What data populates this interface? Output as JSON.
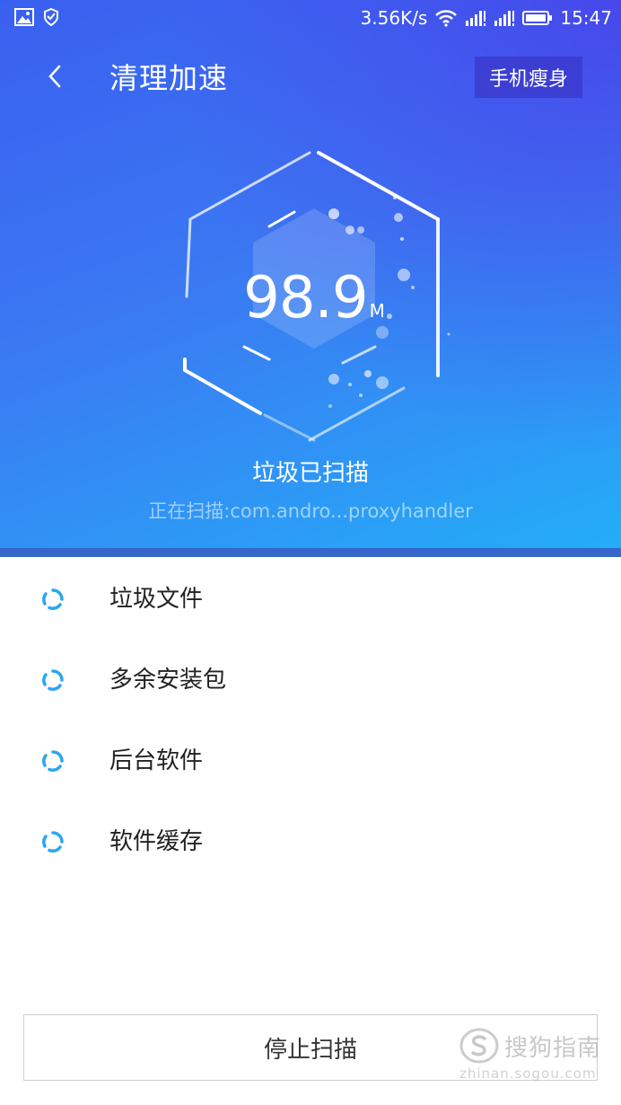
{
  "status_bar": {
    "speed": "3.56K/s",
    "time": "15:47",
    "icons": [
      "image-icon",
      "shield-icon",
      "wifi-icon",
      "signal-icon",
      "signal-icon",
      "battery-icon"
    ]
  },
  "header": {
    "back_icon": "chevron-left-icon",
    "title": "清理加速",
    "right_button": "手机瘦身"
  },
  "gauge": {
    "value": "98.9",
    "unit": "M"
  },
  "scan": {
    "title": "垃圾已扫描",
    "detail": "正在扫描:com.andro...proxyhandler"
  },
  "items": [
    {
      "label": "垃圾文件",
      "icon": "loading-spinner-icon"
    },
    {
      "label": "多余安装包",
      "icon": "loading-spinner-icon"
    },
    {
      "label": "后台软件",
      "icon": "loading-spinner-icon"
    },
    {
      "label": "软件缓存",
      "icon": "loading-spinner-icon"
    }
  ],
  "stop_button": "停止扫描",
  "watermark": {
    "name": "搜狗指南",
    "url": "zhinan.sogou.com"
  },
  "colors": {
    "accent": "#2aa6f0",
    "hero_top": "#3a5ff0",
    "hero_bottom": "#23aef8"
  }
}
